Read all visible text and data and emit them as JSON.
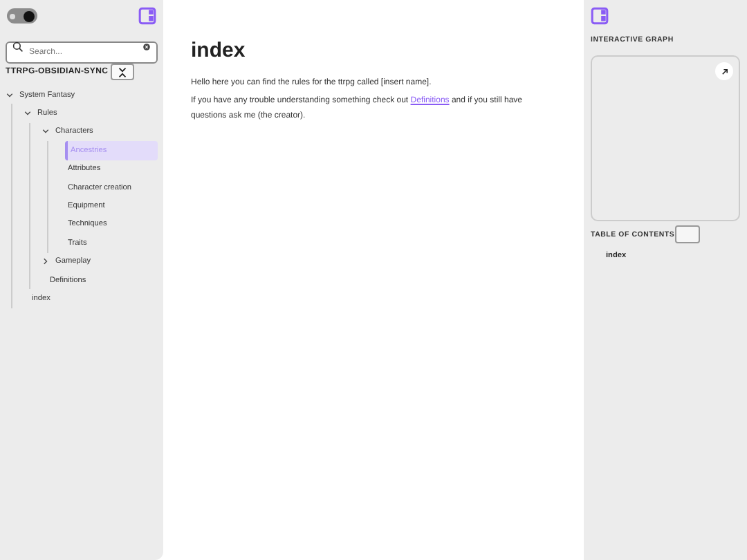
{
  "left_sidebar": {
    "theme_toggle": {
      "on": true
    },
    "search": {
      "placeholder": "Search..."
    },
    "vault_name": "TTRPG-OBSIDIAN-SYNC",
    "tree": [
      {
        "label": "System Fantasy",
        "expanded": true,
        "selected": false,
        "children": [
          {
            "label": "Rules",
            "expanded": true,
            "selected": false,
            "children": [
              {
                "label": "Characters",
                "expanded": true,
                "selected": false,
                "children": [
                  {
                    "label": "Ancestries",
                    "selected": true
                  },
                  {
                    "label": "Attributes",
                    "selected": false
                  },
                  {
                    "label": "Character creation",
                    "selected": false
                  },
                  {
                    "label": "Equipment",
                    "selected": false
                  },
                  {
                    "label": "Techniques",
                    "selected": false
                  },
                  {
                    "label": "Traits",
                    "selected": false
                  }
                ]
              },
              {
                "label": "Gameplay",
                "expanded": false,
                "selected": false
              },
              {
                "label": "Definitions",
                "selected": false
              }
            ]
          },
          {
            "label": "index",
            "selected": false
          }
        ]
      }
    ]
  },
  "main": {
    "title": "index",
    "paragraphs": [
      {
        "before": "Hello here you can find the rules for the ttrpg called [insert name]."
      },
      {
        "before": "If you have any trouble understanding something check out ",
        "link": "Definitions",
        "after": " and if you still have questions ask me (the creator)."
      }
    ]
  },
  "right_sidebar": {
    "graph_title": "INTERACTIVE GRAPH",
    "toc_title": "TABLE OF CONTENTS",
    "toc": [
      {
        "label": "index"
      }
    ]
  }
}
